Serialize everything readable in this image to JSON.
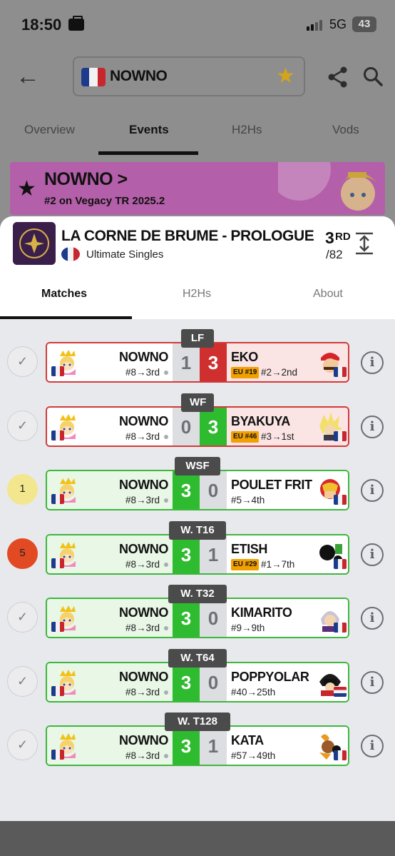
{
  "status_bar": {
    "time": "18:50",
    "network": "5G",
    "battery": "43"
  },
  "header": {
    "player_name": "NOWNO"
  },
  "top_tabs": [
    "Overview",
    "Events",
    "H2Hs",
    "Vods"
  ],
  "banner": {
    "name": "NOWNO >",
    "subtitle": "#2 on Vegacy TR 2025.2"
  },
  "event": {
    "title": "LA CORNE DE BRUME - PROLOGUE",
    "type": "Ultimate Singles",
    "placement_num": "3",
    "placement_suffix": "RD",
    "placement_of": "/82"
  },
  "sub_tabs": [
    "Matches",
    "H2Hs",
    "About"
  ],
  "colors": {
    "win": "#2fbb2f",
    "loss": "#cf2f2f",
    "badge": "#f2a000",
    "banner": "#e070d0"
  },
  "matches": [
    {
      "round": "LF",
      "marker": "✓",
      "player": "NOWNO",
      "player_seed": "#8→3rd",
      "score_player": "1",
      "score_opponent": "3",
      "opponent": "EKO",
      "badge": "EU #19",
      "opponent_seed": "#2→2nd",
      "opponent_char": "mario-icon",
      "result": "loss"
    },
    {
      "round": "WF",
      "marker": "✓",
      "player": "NOWNO",
      "player_seed": "#8→3rd",
      "score_player": "0",
      "score_opponent": "3",
      "opponent": "BYAKUYA",
      "badge": "EU #46",
      "opponent_seed": "#3→1st",
      "opponent_char": "cloud-icon",
      "result": "loss"
    },
    {
      "round": "WSF",
      "marker": "1",
      "player": "NOWNO",
      "player_seed": "#8→3rd",
      "score_player": "3",
      "score_opponent": "0",
      "opponent": "POULET FRIT",
      "badge": "",
      "opponent_seed": "#5→4th",
      "opponent_char": "captain-falcon-icon",
      "result": "win"
    },
    {
      "round": "W. T16",
      "marker": "5",
      "player": "NOWNO",
      "player_seed": "#8→3rd",
      "score_player": "3",
      "score_opponent": "1",
      "opponent": "ETISH",
      "badge": "EU #29",
      "opponent_seed": "#1→7th",
      "opponent_char": "game-and-watch-icon",
      "result": "win"
    },
    {
      "round": "W. T32",
      "marker": "✓",
      "player": "NOWNO",
      "player_seed": "#8→3rd",
      "score_player": "3",
      "score_opponent": "0",
      "opponent": "KIMARITO",
      "badge": "",
      "opponent_seed": "#9→9th",
      "opponent_char": "robin-icon",
      "result": "win"
    },
    {
      "round": "W. T64",
      "marker": "✓",
      "player": "NOWNO",
      "player_seed": "#8→3rd",
      "score_player": "3",
      "score_opponent": "0",
      "opponent": "POPPYOLAR",
      "badge": "",
      "opponent_seed": "#40→25th",
      "opponent_char": "joker-icon",
      "result": "win"
    },
    {
      "round": "W. T128",
      "marker": "✓",
      "player": "NOWNO",
      "player_seed": "#8→3rd",
      "score_player": "3",
      "score_opponent": "1",
      "opponent": "KATA",
      "badge": "",
      "opponent_seed": "#57→49th",
      "opponent_char": "banjo-icon",
      "result": "win"
    }
  ]
}
